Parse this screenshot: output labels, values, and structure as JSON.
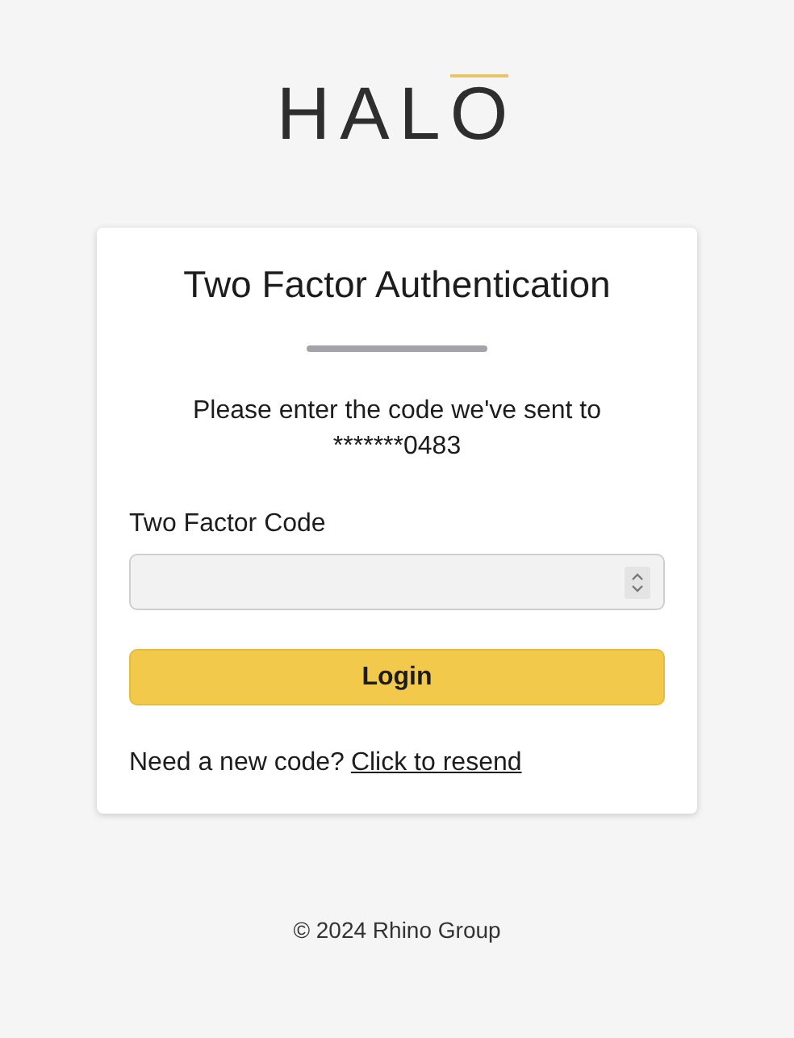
{
  "logo": {
    "text": "HALO"
  },
  "card": {
    "title": "Two Factor Authentication",
    "message": "Please enter the code we've sent to",
    "masked_number": "*******0483",
    "field_label": "Two Factor Code",
    "login_button": "Login",
    "resend_prompt": "Need a new code?",
    "resend_link": "Click to resend"
  },
  "footer": "© 2024 Rhino Group"
}
